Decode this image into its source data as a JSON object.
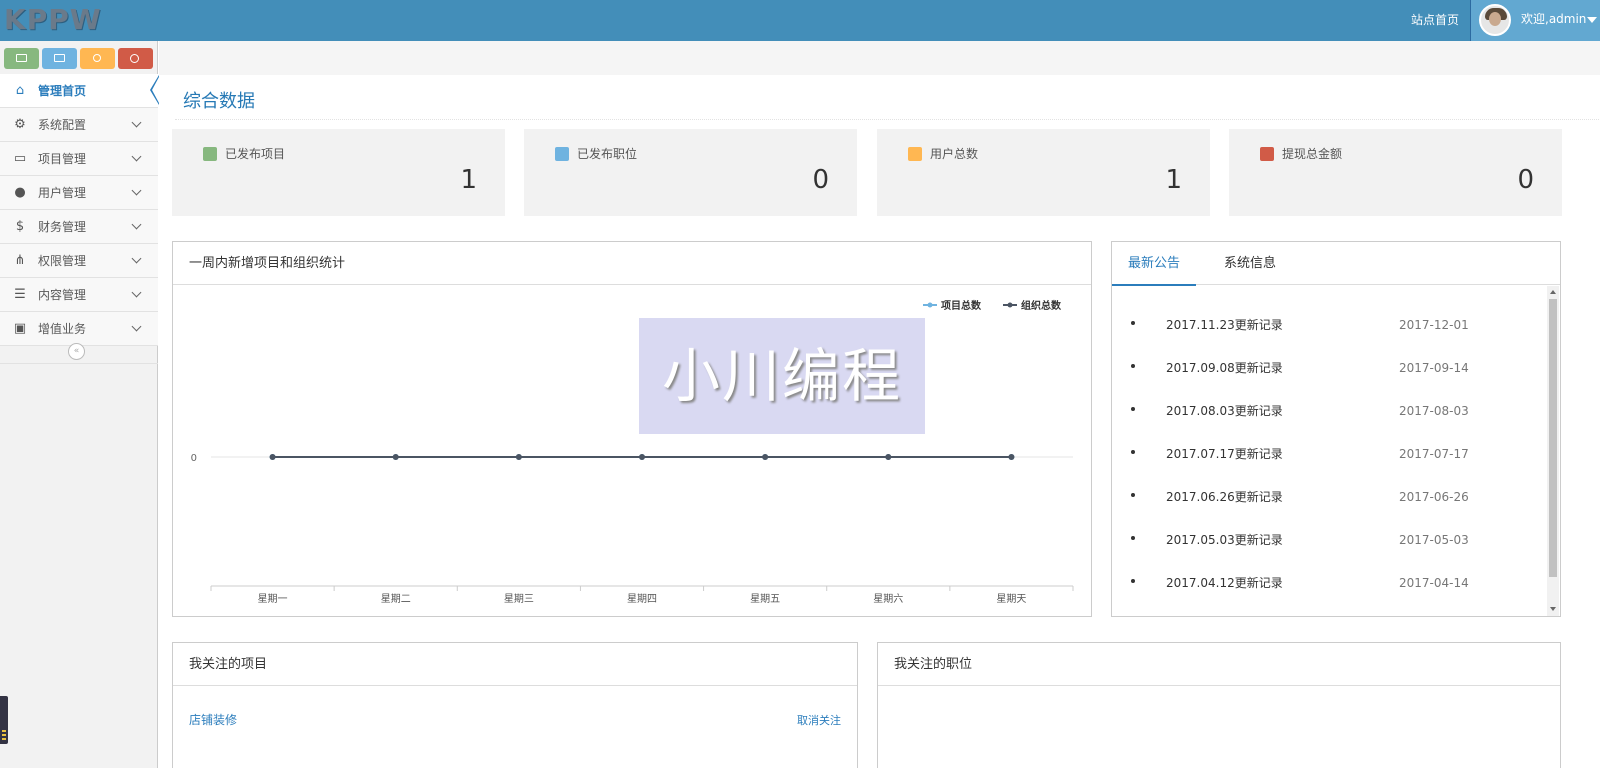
{
  "header": {
    "logo": "KPPW",
    "site_home": "站点首页",
    "welcome": "欢迎,admin"
  },
  "colors": {
    "topbar": "#438eb9",
    "accent": "#2b7dbc",
    "shortcut_green": "#87b87f",
    "shortcut_blue": "#6fb3e0",
    "shortcut_orange": "#ffb752",
    "shortcut_red": "#d15b47"
  },
  "sidebar": {
    "shortcuts": [
      "monitor-icon",
      "camera-icon",
      "user-icon",
      "cogs-icon"
    ],
    "items": [
      {
        "label": "管理首页",
        "icon": "home-icon",
        "active": true
      },
      {
        "label": "系统配置",
        "icon": "gear-icon"
      },
      {
        "label": "项目管理",
        "icon": "laptop-icon"
      },
      {
        "label": "用户管理",
        "icon": "users-icon"
      },
      {
        "label": "财务管理",
        "icon": "dollar-icon"
      },
      {
        "label": "权限管理",
        "icon": "sitemap-icon"
      },
      {
        "label": "内容管理",
        "icon": "list-icon"
      },
      {
        "label": "增值业务",
        "icon": "briefcase-icon"
      }
    ],
    "collapse": "«"
  },
  "main": {
    "title": "综合数据",
    "stats": [
      {
        "label": "已发布项目",
        "value": "1",
        "icon": "copy-icon",
        "color": "#87b87f"
      },
      {
        "label": "已发布职位",
        "value": "0",
        "icon": "book-icon",
        "color": "#6fb3e0"
      },
      {
        "label": "用户总数",
        "value": "1",
        "icon": "group-icon",
        "color": "#ffb752"
      },
      {
        "label": "提现总金额",
        "value": "0",
        "icon": "credit-card-icon",
        "color": "#d15b47"
      }
    ],
    "chart_panel_title": "一周内新增项目和组织统计",
    "watermark": "小川编程",
    "announcements": {
      "tabs": [
        "最新公告",
        "系统信息"
      ],
      "items": [
        {
          "title": "2017.11.23更新记录",
          "date": "2017-12-01"
        },
        {
          "title": "2017.09.08更新记录",
          "date": "2017-09-14"
        },
        {
          "title": "2017.08.03更新记录",
          "date": "2017-08-03"
        },
        {
          "title": "2017.07.17更新记录",
          "date": "2017-07-17"
        },
        {
          "title": "2017.06.26更新记录",
          "date": "2017-06-26"
        },
        {
          "title": "2017.05.03更新记录",
          "date": "2017-05-03"
        },
        {
          "title": "2017.04.12更新记录",
          "date": "2017-04-14"
        }
      ]
    },
    "followed_projects": {
      "title": "我关注的项目",
      "items": [
        {
          "name": "店铺装修",
          "action": "取消关注"
        }
      ]
    },
    "followed_jobs": {
      "title": "我关注的职位"
    }
  },
  "chart_data": {
    "type": "line",
    "categories": [
      "星期一",
      "星期二",
      "星期三",
      "星期四",
      "星期五",
      "星期六",
      "星期天"
    ],
    "series": [
      {
        "name": "项目总数",
        "values": [
          0,
          0,
          0,
          0,
          0,
          0,
          0
        ],
        "color": "#6fb3e0"
      },
      {
        "name": "组织总数",
        "values": [
          0,
          0,
          0,
          0,
          0,
          0,
          0
        ],
        "color": "#4b5563"
      }
    ],
    "yticks": [
      "0"
    ],
    "legend": "top-right",
    "grid": true
  }
}
